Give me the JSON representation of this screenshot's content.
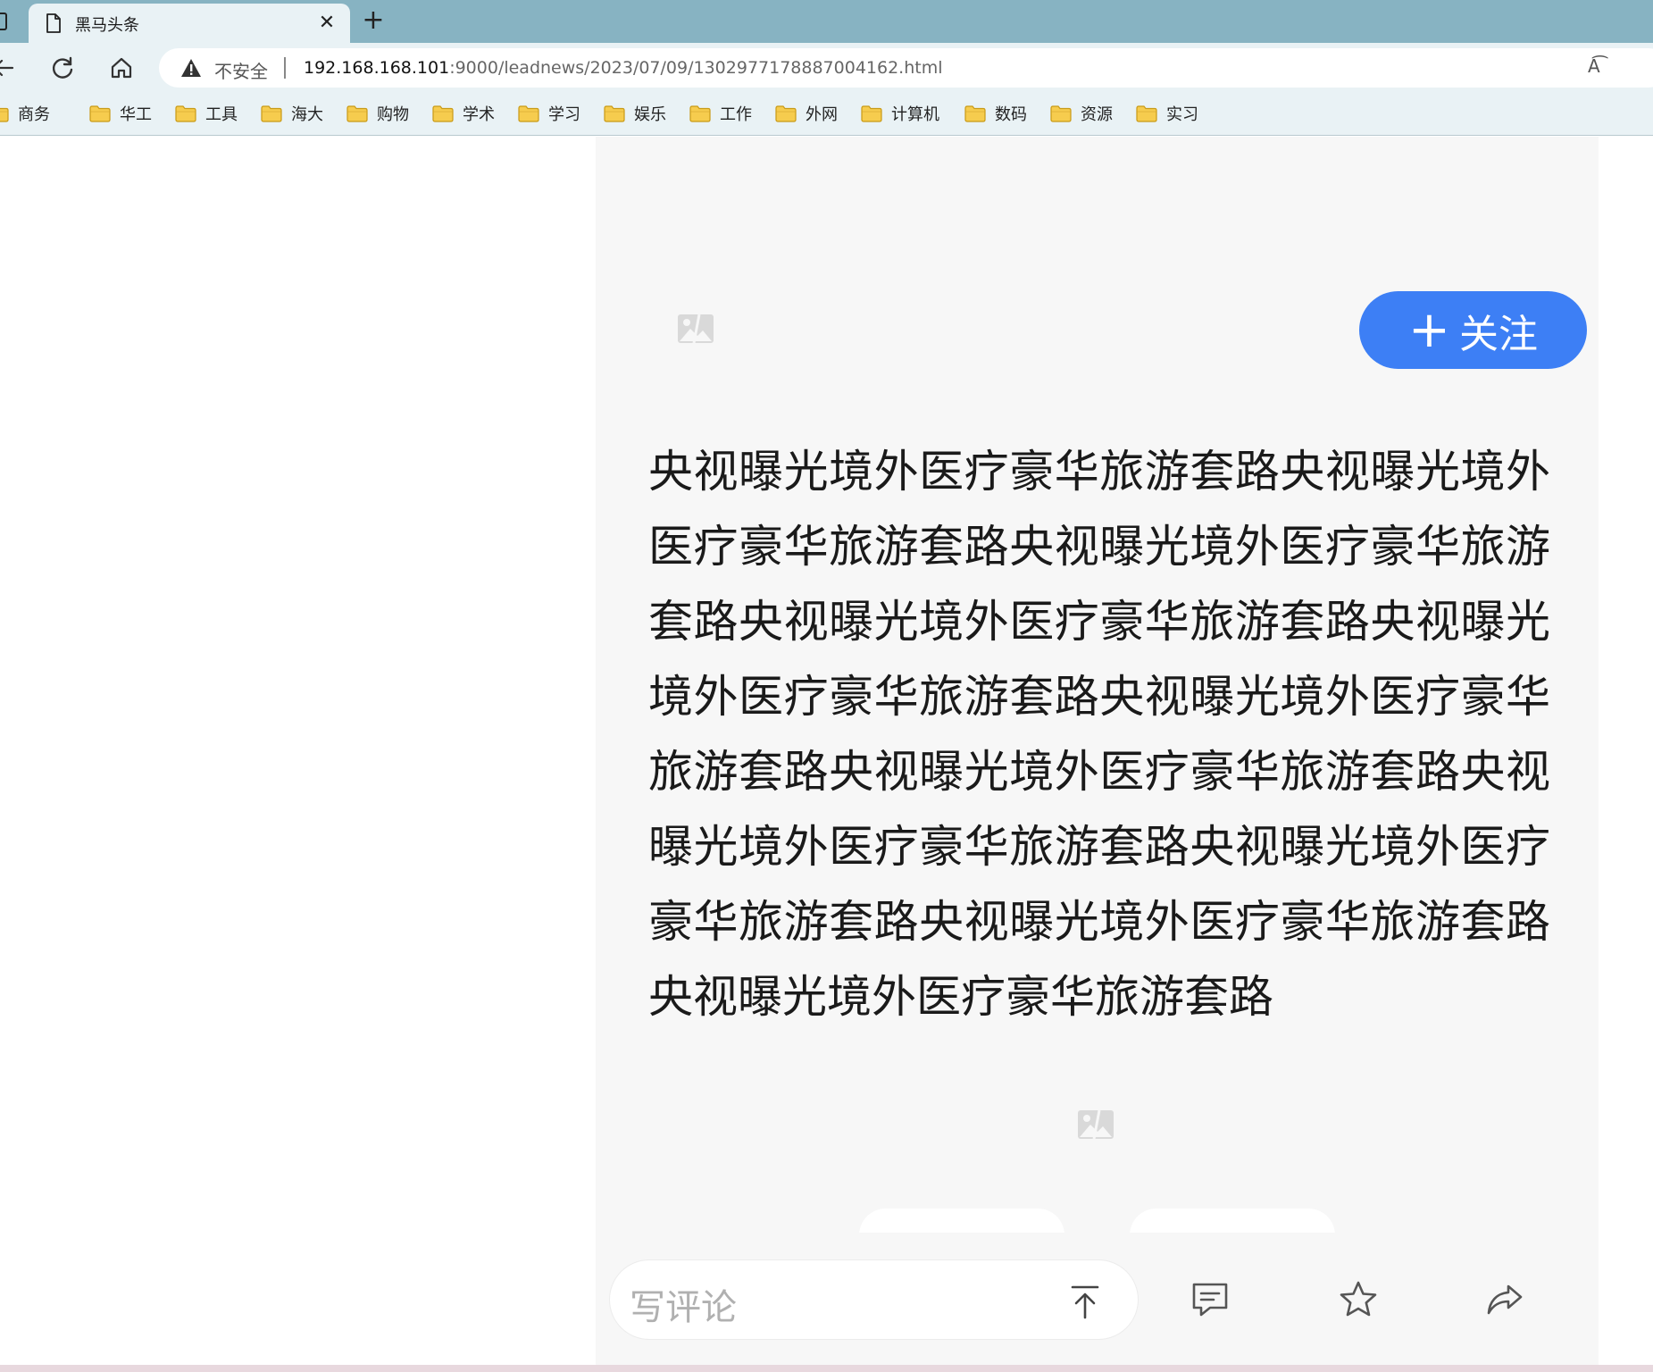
{
  "browser": {
    "tab": {
      "title": "黑马头条",
      "close_icon": "close-icon",
      "new_tab_icon": "plus-icon"
    },
    "address_bar": {
      "security_label": "不安全",
      "url_host": "192.168.168.101",
      "url_path": ":9000/leadnews/2023/07/09/1302977178887004162.html",
      "read_aloud": "A͡"
    },
    "bookmarks": [
      {
        "label": "商务"
      },
      {
        "label": "华工"
      },
      {
        "label": "工具"
      },
      {
        "label": "海大"
      },
      {
        "label": "购物"
      },
      {
        "label": "学术"
      },
      {
        "label": "学习"
      },
      {
        "label": "娱乐"
      },
      {
        "label": "工作"
      },
      {
        "label": "外网"
      },
      {
        "label": "计算机"
      },
      {
        "label": "数码"
      },
      {
        "label": "资源"
      },
      {
        "label": "实习"
      }
    ],
    "colors": {
      "tabbar": "#87b3c2",
      "toolbar": "#e9f2f5"
    }
  },
  "article": {
    "follow_plus": "+",
    "follow_label": "关注",
    "body": "央视曝光境外医疗豪华旅游套路央视曝光境外医疗豪华旅游套路央视曝光境外医疗豪华旅游套路央视曝光境外医疗豪华旅游套路央视曝光境外医疗豪华旅游套路央视曝光境外医疗豪华旅游套路央视曝光境外医疗豪华旅游套路央视曝光境外医疗豪华旅游套路央视曝光境外医疗豪华旅游套路央视曝光境外医疗豪华旅游套路央视曝光境外医疗豪华旅游套路",
    "image_icon": "broken-image-icon",
    "colors": {
      "follow": "#3d7ff5",
      "background": "#f7f7f7"
    }
  },
  "bottom_bar": {
    "comment_placeholder": "写评论",
    "icons": [
      "send-icon",
      "comments-icon",
      "star-icon",
      "share-icon"
    ]
  }
}
